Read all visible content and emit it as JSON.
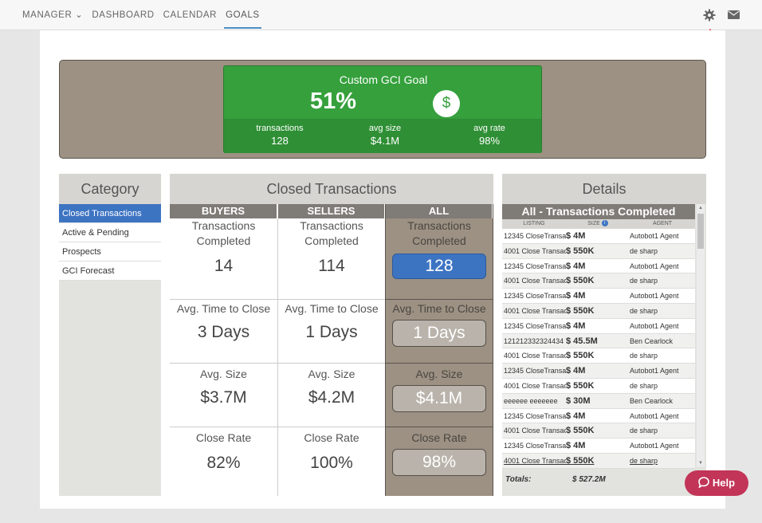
{
  "nav": {
    "items": [
      {
        "label": "MANAGER ⌄"
      },
      {
        "label": "DASHBOARD"
      },
      {
        "label": "CALENDAR"
      },
      {
        "label": "GOALS"
      }
    ],
    "active_index": 3,
    "gear_icon": "gear-icon",
    "mail_icon": "mail-icon"
  },
  "goal": {
    "title": "Custom GCI Goal",
    "percent": "51%",
    "icon_symbol": "$",
    "stats": [
      {
        "label": "transactions",
        "value": "128"
      },
      {
        "label": "avg size",
        "value": "$4.1M"
      },
      {
        "label": "avg rate",
        "value": "98%"
      }
    ],
    "colors": {
      "green": "#35a03c",
      "frame": "#9c9183"
    }
  },
  "category": {
    "title": "Category",
    "items": [
      {
        "label": "Closed Transactions",
        "active": true
      },
      {
        "label": "Active & Pending"
      },
      {
        "label": "Prospects"
      },
      {
        "label": "GCI Forecast"
      }
    ]
  },
  "closed": {
    "title": "Closed Transactions",
    "columns": [
      {
        "header": "BUYERS",
        "completed_label": "Transactions Completed",
        "completed": "14",
        "time_label": "Avg. Time to Close",
        "time": "3 Days",
        "size_label": "Avg. Size",
        "size": "$3.7M",
        "rate_label": "Close Rate",
        "rate": "82%"
      },
      {
        "header": "SELLERS",
        "completed_label": "Transactions Completed",
        "completed": "114",
        "time_label": "Avg. Time to Close",
        "time": "1 Days",
        "size_label": "Avg. Size",
        "size": "$4.2M",
        "rate_label": "Close Rate",
        "rate": "100%"
      },
      {
        "header": "ALL",
        "completed_label": "Transactions Completed",
        "completed": "128",
        "time_label": "Avg. Time to Close",
        "time": "1 Days",
        "size_label": "Avg. Size",
        "size": "$4.1M",
        "rate_label": "Close Rate",
        "rate": "98%"
      }
    ]
  },
  "details": {
    "title": "Details",
    "table_title": "All - Transactions Completed",
    "headers": [
      "LISTING",
      "SIZE",
      "AGENT"
    ],
    "rows": [
      [
        "12345 CloseTransa",
        "$ 4M",
        "Autobot1 Agent"
      ],
      [
        "4001 Close Transac",
        "$ 550K",
        "de sharp"
      ],
      [
        "12345 CloseTransa",
        "$ 4M",
        "Autobot1 Agent"
      ],
      [
        "4001 Close Transac",
        "$ 550K",
        "de sharp"
      ],
      [
        "12345 CloseTransa",
        "$ 4M",
        "Autobot1 Agent"
      ],
      [
        "4001 Close Transac",
        "$ 550K",
        "de sharp"
      ],
      [
        "12345 CloseTransa",
        "$ 4M",
        "Autobot1 Agent"
      ],
      [
        "121212332324434",
        "$ 45.5M",
        "Ben Cearlock"
      ],
      [
        "4001 Close Transac",
        "$ 550K",
        "de sharp"
      ],
      [
        "12345 CloseTransa",
        "$ 4M",
        "Autobot1 Agent"
      ],
      [
        "4001 Close Transac",
        "$ 550K",
        "de sharp"
      ],
      [
        "eeeeee eeeeeee",
        "$ 30M",
        "Ben Cearlock"
      ],
      [
        "12345 CloseTransa",
        "$ 4M",
        "Autobot1 Agent"
      ],
      [
        "4001 Close Transac",
        "$ 550K",
        "de sharp"
      ],
      [
        "12345 CloseTransa",
        "$ 4M",
        "Autobot1 Agent"
      ],
      [
        "4001 Close Transac",
        "$ 550K",
        "de sharp"
      ]
    ],
    "totals_label": "Totals:",
    "totals_value": "$ 527.2M"
  },
  "help": {
    "label": "Help"
  }
}
